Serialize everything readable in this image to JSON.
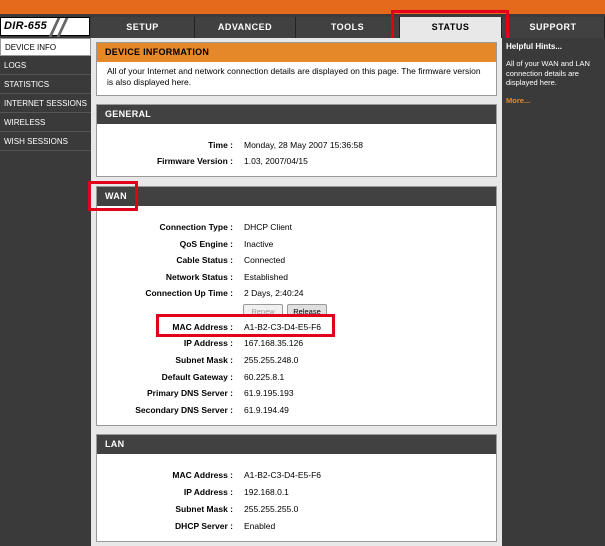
{
  "app": {
    "logo": "DIR-655"
  },
  "tabs": {
    "setup": "SETUP",
    "advanced": "ADVANCED",
    "tools": "TOOLS",
    "status": "STATUS",
    "support": "SUPPORT"
  },
  "sidebar": {
    "items": [
      "DEVICE INFO",
      "LOGS",
      "STATISTICS",
      "INTERNET SESSIONS",
      "WIRELESS",
      "WISH SESSIONS"
    ]
  },
  "device_info": {
    "title": "DEVICE INFORMATION",
    "description": "All of your Internet and network connection details are displayed on this page. The firmware version is also displayed here."
  },
  "general": {
    "title": "GENERAL",
    "time_label": "Time :",
    "time_value": "Monday, 28 May 2007 15:36:58",
    "firmware_label": "Firmware Version :",
    "firmware_value": "1.03,  2007/04/15"
  },
  "wan": {
    "title": "WAN",
    "rows": [
      {
        "label": "Connection Type :",
        "value": "DHCP Client"
      },
      {
        "label": "QoS Engine :",
        "value": "Inactive"
      },
      {
        "label": "Cable Status :",
        "value": "Connected"
      },
      {
        "label": "Network Status :",
        "value": "Established"
      },
      {
        "label": "Connection Up Time :",
        "value": "2 Days, 2:40:24"
      },
      {
        "label": "MAC Address :",
        "value": "A1-B2-C3-D4-E5-F6"
      },
      {
        "label": "IP Address :",
        "value": "167.168.35.126"
      },
      {
        "label": "Subnet Mask :",
        "value": "255.255.248.0"
      },
      {
        "label": "Default Gateway :",
        "value": "60.225.8.1"
      },
      {
        "label": "Primary DNS Server :",
        "value": "61.9.195.193"
      },
      {
        "label": "Secondary DNS Server :",
        "value": "61.9.194.49"
      }
    ],
    "renew_label": "Renew",
    "release_label": "Release"
  },
  "lan": {
    "title": "LAN",
    "rows": [
      {
        "label": "MAC Address :",
        "value": "A1-B2-C3-D4-E5-F6"
      },
      {
        "label": "IP Address :",
        "value": "192.168.0.1"
      },
      {
        "label": "Subnet Mask :",
        "value": "255.255.255.0"
      },
      {
        "label": "DHCP Server :",
        "value": "Enabled"
      }
    ]
  },
  "hints": {
    "title": "Helpful Hints...",
    "body": "All of your WAN and LAN connection details are displayed here.",
    "more": "More..."
  },
  "colors": {
    "accent": "#e5882a",
    "header_strip": "#e56a1c",
    "dark": "#3a3a3a",
    "annotation": "#e3001b"
  }
}
